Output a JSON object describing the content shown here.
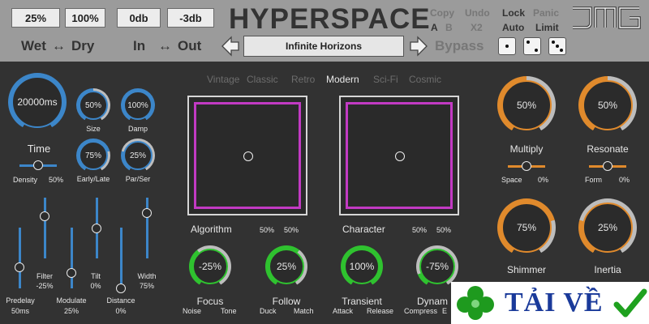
{
  "header": {
    "box_wet": "25%",
    "box_dry": "100%",
    "box_in": "0db",
    "box_out": "-3db",
    "wet_label": "Wet",
    "swap_wetdry": "↔",
    "dry_label": "Dry",
    "in_label": "In",
    "swap_inout": "↔",
    "out_label": "Out",
    "title": "HYPERSPACE",
    "preset": "Infinite Horizons",
    "bypass": "Bypass",
    "copy": "Copy",
    "a": "A",
    "b": "B",
    "undo": "Undo",
    "x2": "X2",
    "lock": "Lock",
    "auto": "Auto",
    "panic": "Panic",
    "limit": "Limit",
    "logo": "JMG"
  },
  "tabs": {
    "vintage": "Vintage",
    "classic": "Classic",
    "retro": "Retro",
    "modern": "Modern",
    "scifi": "Sci-Fi",
    "cosmic": "Cosmic",
    "active": "Modern"
  },
  "left": {
    "time_value": "20000ms",
    "time_label": "Time",
    "size_value": "50%",
    "size_label": "Size",
    "damp_value": "100%",
    "damp_label": "Damp",
    "early_value": "75%",
    "early_label": "Early/Late",
    "parser_value": "25%",
    "parser_label": "Par/Ser",
    "density_label": "Density",
    "density_value": "50%",
    "density_level": 0.5,
    "sliders": [
      {
        "label": "Predelay",
        "value": "50ms",
        "level": 0.35
      },
      {
        "label": "Filter",
        "value": "-25%",
        "level": 0.7
      },
      {
        "label": "Modulate",
        "value": "25%",
        "level": 0.25
      },
      {
        "label": "Tilt",
        "value": "0%",
        "level": 0.5
      },
      {
        "label": "Distance",
        "value": "0%",
        "level": 0.0
      },
      {
        "label": "Width",
        "value": "75%",
        "level": 0.75
      }
    ]
  },
  "center": {
    "algorithm_label": "Algorithm",
    "algorithm_x": "50%",
    "algorithm_y": "50%",
    "character_label": "Character",
    "character_x": "50%",
    "character_y": "50%",
    "focus_value": "-25%",
    "focus_label": "Focus",
    "focus_left": "Noise",
    "focus_right": "Tone",
    "follow_value": "25%",
    "follow_label": "Follow",
    "follow_left": "Duck",
    "follow_right": "Match",
    "transient_value": "100%",
    "transient_label": "Transient",
    "transient_left": "Attack",
    "transient_right": "Release",
    "dynamic_value": "-75%",
    "dynamic_label": "Dynam",
    "dynamic_left": "Compress",
    "dynamic_right": "E"
  },
  "right": {
    "multiply_value": "50%",
    "multiply_label": "Multiply",
    "resonate_value": "50%",
    "resonate_label": "Resonate",
    "space_label": "Space",
    "space_value": "0%",
    "form_label": "Form",
    "form_value": "0%",
    "shimmer_value": "75%",
    "shimmer_label": "Shimmer",
    "inertia_value": "25%",
    "inertia_label": "Inertia"
  },
  "badge": {
    "text": "TẢI VỀ"
  },
  "colors": {
    "blue": "#3c86c9",
    "green": "#2fc22f",
    "orange": "#e08a2c",
    "magenta": "#c23ac3",
    "header_bg": "#9b9b9b"
  }
}
